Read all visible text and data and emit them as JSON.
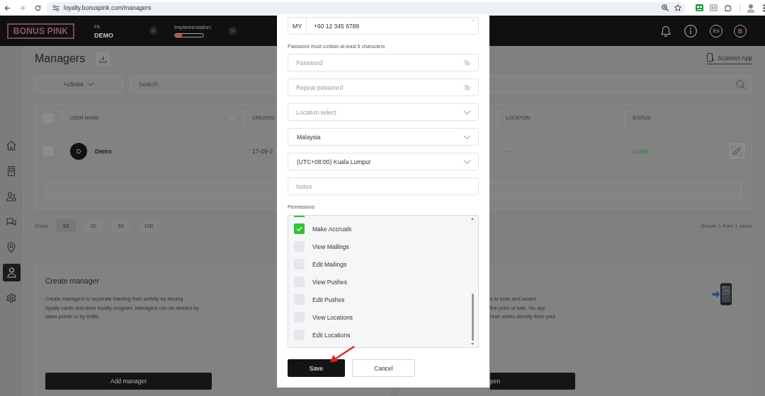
{
  "browser": {
    "url": "loyalty.bonuspink.com/managers"
  },
  "header": {
    "logo": "BONUS PINK",
    "greeting": "Hi,",
    "user": "DEMO",
    "implementation": {
      "label": "Implementation:",
      "level": 0.25
    },
    "language": "En",
    "account": "B"
  },
  "sidebar": {
    "items": [
      {
        "kind": "home",
        "selected": false
      },
      {
        "kind": "scanner",
        "selected": false
      },
      {
        "kind": "users",
        "selected": false
      },
      {
        "kind": "chat",
        "selected": false
      },
      {
        "kind": "location",
        "selected": false
      },
      {
        "kind": "manager",
        "selected": true
      },
      {
        "kind": "settings",
        "selected": false
      }
    ]
  },
  "page": {
    "title": "Managers",
    "scanner_link": "Scanner App",
    "actions": "Actions",
    "search": {
      "placeholder": "Search"
    }
  },
  "table": {
    "select_all": {
      "checked": false
    },
    "columns": [
      "USER NAME",
      "CREATED",
      "LOCATION",
      "STATUS"
    ],
    "rows": [
      {
        "checked": false,
        "avatar": "D",
        "name": "Demo",
        "created": "17-09-2",
        "location": "-",
        "status": "Active",
        "active": true
      }
    ]
  },
  "pagination": {
    "label": "Show",
    "sizes": [
      {
        "label": "10",
        "selected": true
      },
      {
        "label": "20",
        "selected": false
      },
      {
        "label": "50",
        "selected": false
      },
      {
        "label": "100",
        "selected": false
      }
    ],
    "summary": "Shown 1 from 1 users"
  },
  "cards": [
    {
      "kind": "full",
      "title": "Create manager",
      "lines": [
        "Create managers to separate tracking their activity by issuing",
        "loyalty cards and drive loyalty program. Managers can be divided by",
        "sales points or by shifts."
      ],
      "button": "Add manager"
    },
    {
      "kind": "covered",
      "lines": [
        "s to scan and award",
        "the point of sale. No app",
        "nner works directly from your"
      ],
      "button": "pen"
    }
  ],
  "modal": {
    "phone": {
      "country": "MY",
      "value": "+60 12 345 6789",
      "required_mark": "*"
    },
    "password_hint": "Password must contain at least 6 characters",
    "fields": [
      {
        "kind": "password",
        "placeholder": "Password"
      },
      {
        "kind": "password",
        "placeholder": "Repeat password"
      },
      {
        "kind": "select",
        "placeholder": "Location select"
      },
      {
        "kind": "select",
        "value": "Malaysia"
      },
      {
        "kind": "select",
        "value": "(UTC+08:00) Kuala Lumpur"
      },
      {
        "kind": "text",
        "placeholder": "Notes"
      }
    ],
    "permissions": {
      "label": "Permissions",
      "items": [
        {
          "kind": "clipped",
          "checked": true
        },
        {
          "kind": "full",
          "label": "Make Accruals",
          "checked": true
        },
        {
          "kind": "full",
          "label": "View Mailings",
          "checked": false
        },
        {
          "kind": "full",
          "label": "Edit Mailings",
          "checked": false
        },
        {
          "kind": "full",
          "label": "View Pushes",
          "checked": false
        },
        {
          "kind": "full",
          "label": "Edit Pushes",
          "checked": false
        },
        {
          "kind": "full",
          "label": "View Locations",
          "checked": false
        },
        {
          "kind": "full",
          "label": "Edit Locations",
          "checked": false
        }
      ]
    },
    "buttons": [
      {
        "kind": "primary",
        "label": "Save"
      },
      {
        "kind": "secondary",
        "label": "Cancel"
      }
    ]
  },
  "annotations": [
    {
      "kind": "arrow"
    }
  ]
}
